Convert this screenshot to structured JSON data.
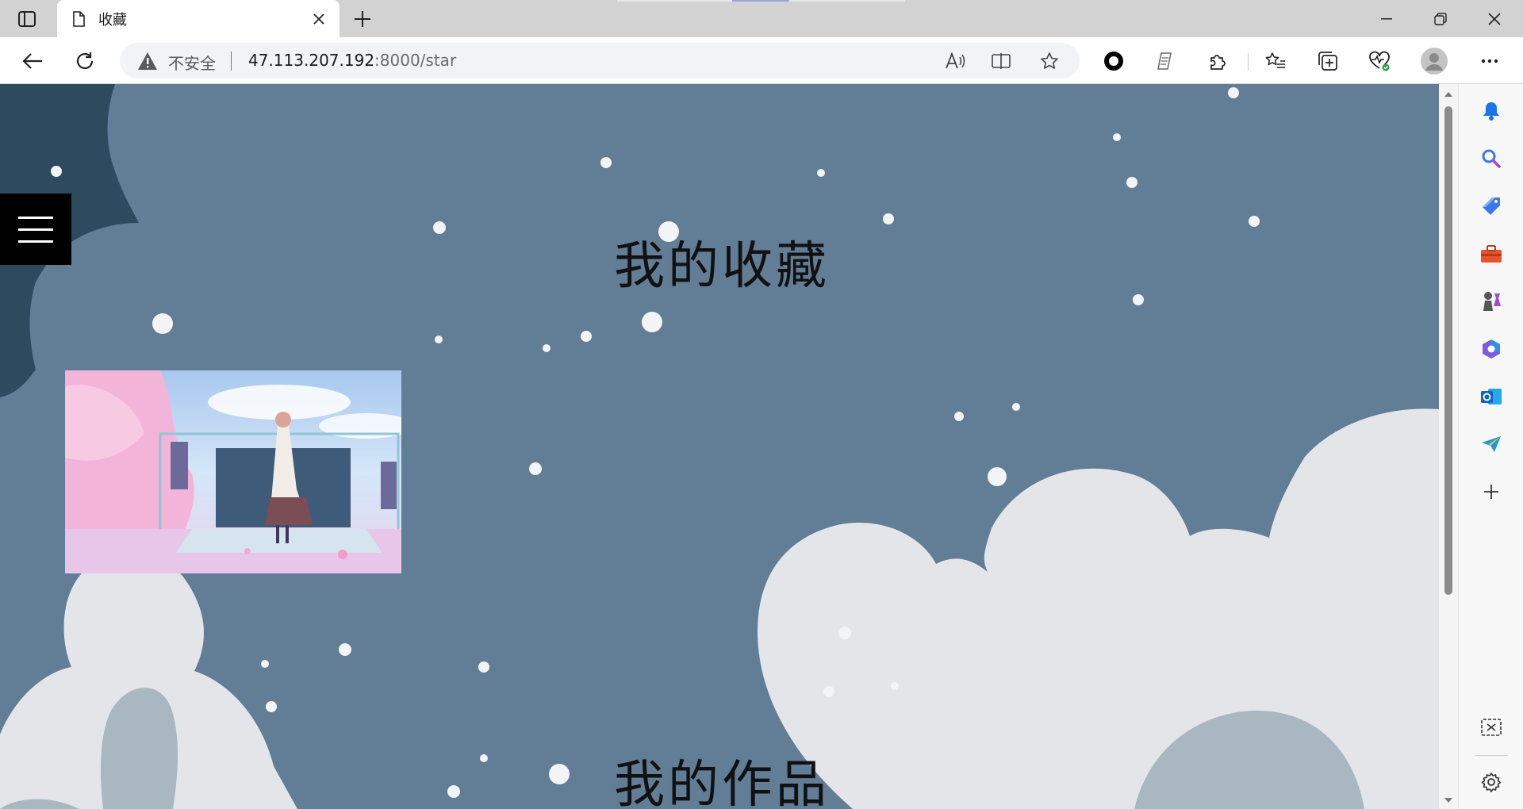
{
  "browser": {
    "tab": {
      "title": "收藏"
    },
    "address_bar": {
      "security_label": "不安全",
      "url_host": "47.113.207.192",
      "url_path": ":8000/star"
    }
  },
  "page": {
    "sections": [
      {
        "title": "我的收藏"
      },
      {
        "title": "我的作品"
      }
    ],
    "favorites": [
      {
        "thumbnail": "anime-girl-cherry-blossom-stage"
      }
    ]
  },
  "colors": {
    "page_background": "#627d96",
    "cloud_light": "#e3e5e9",
    "cloud_grey": "#a9b7c1",
    "cloud_dark": "#2e4a5f",
    "menu_button": "#000000"
  }
}
